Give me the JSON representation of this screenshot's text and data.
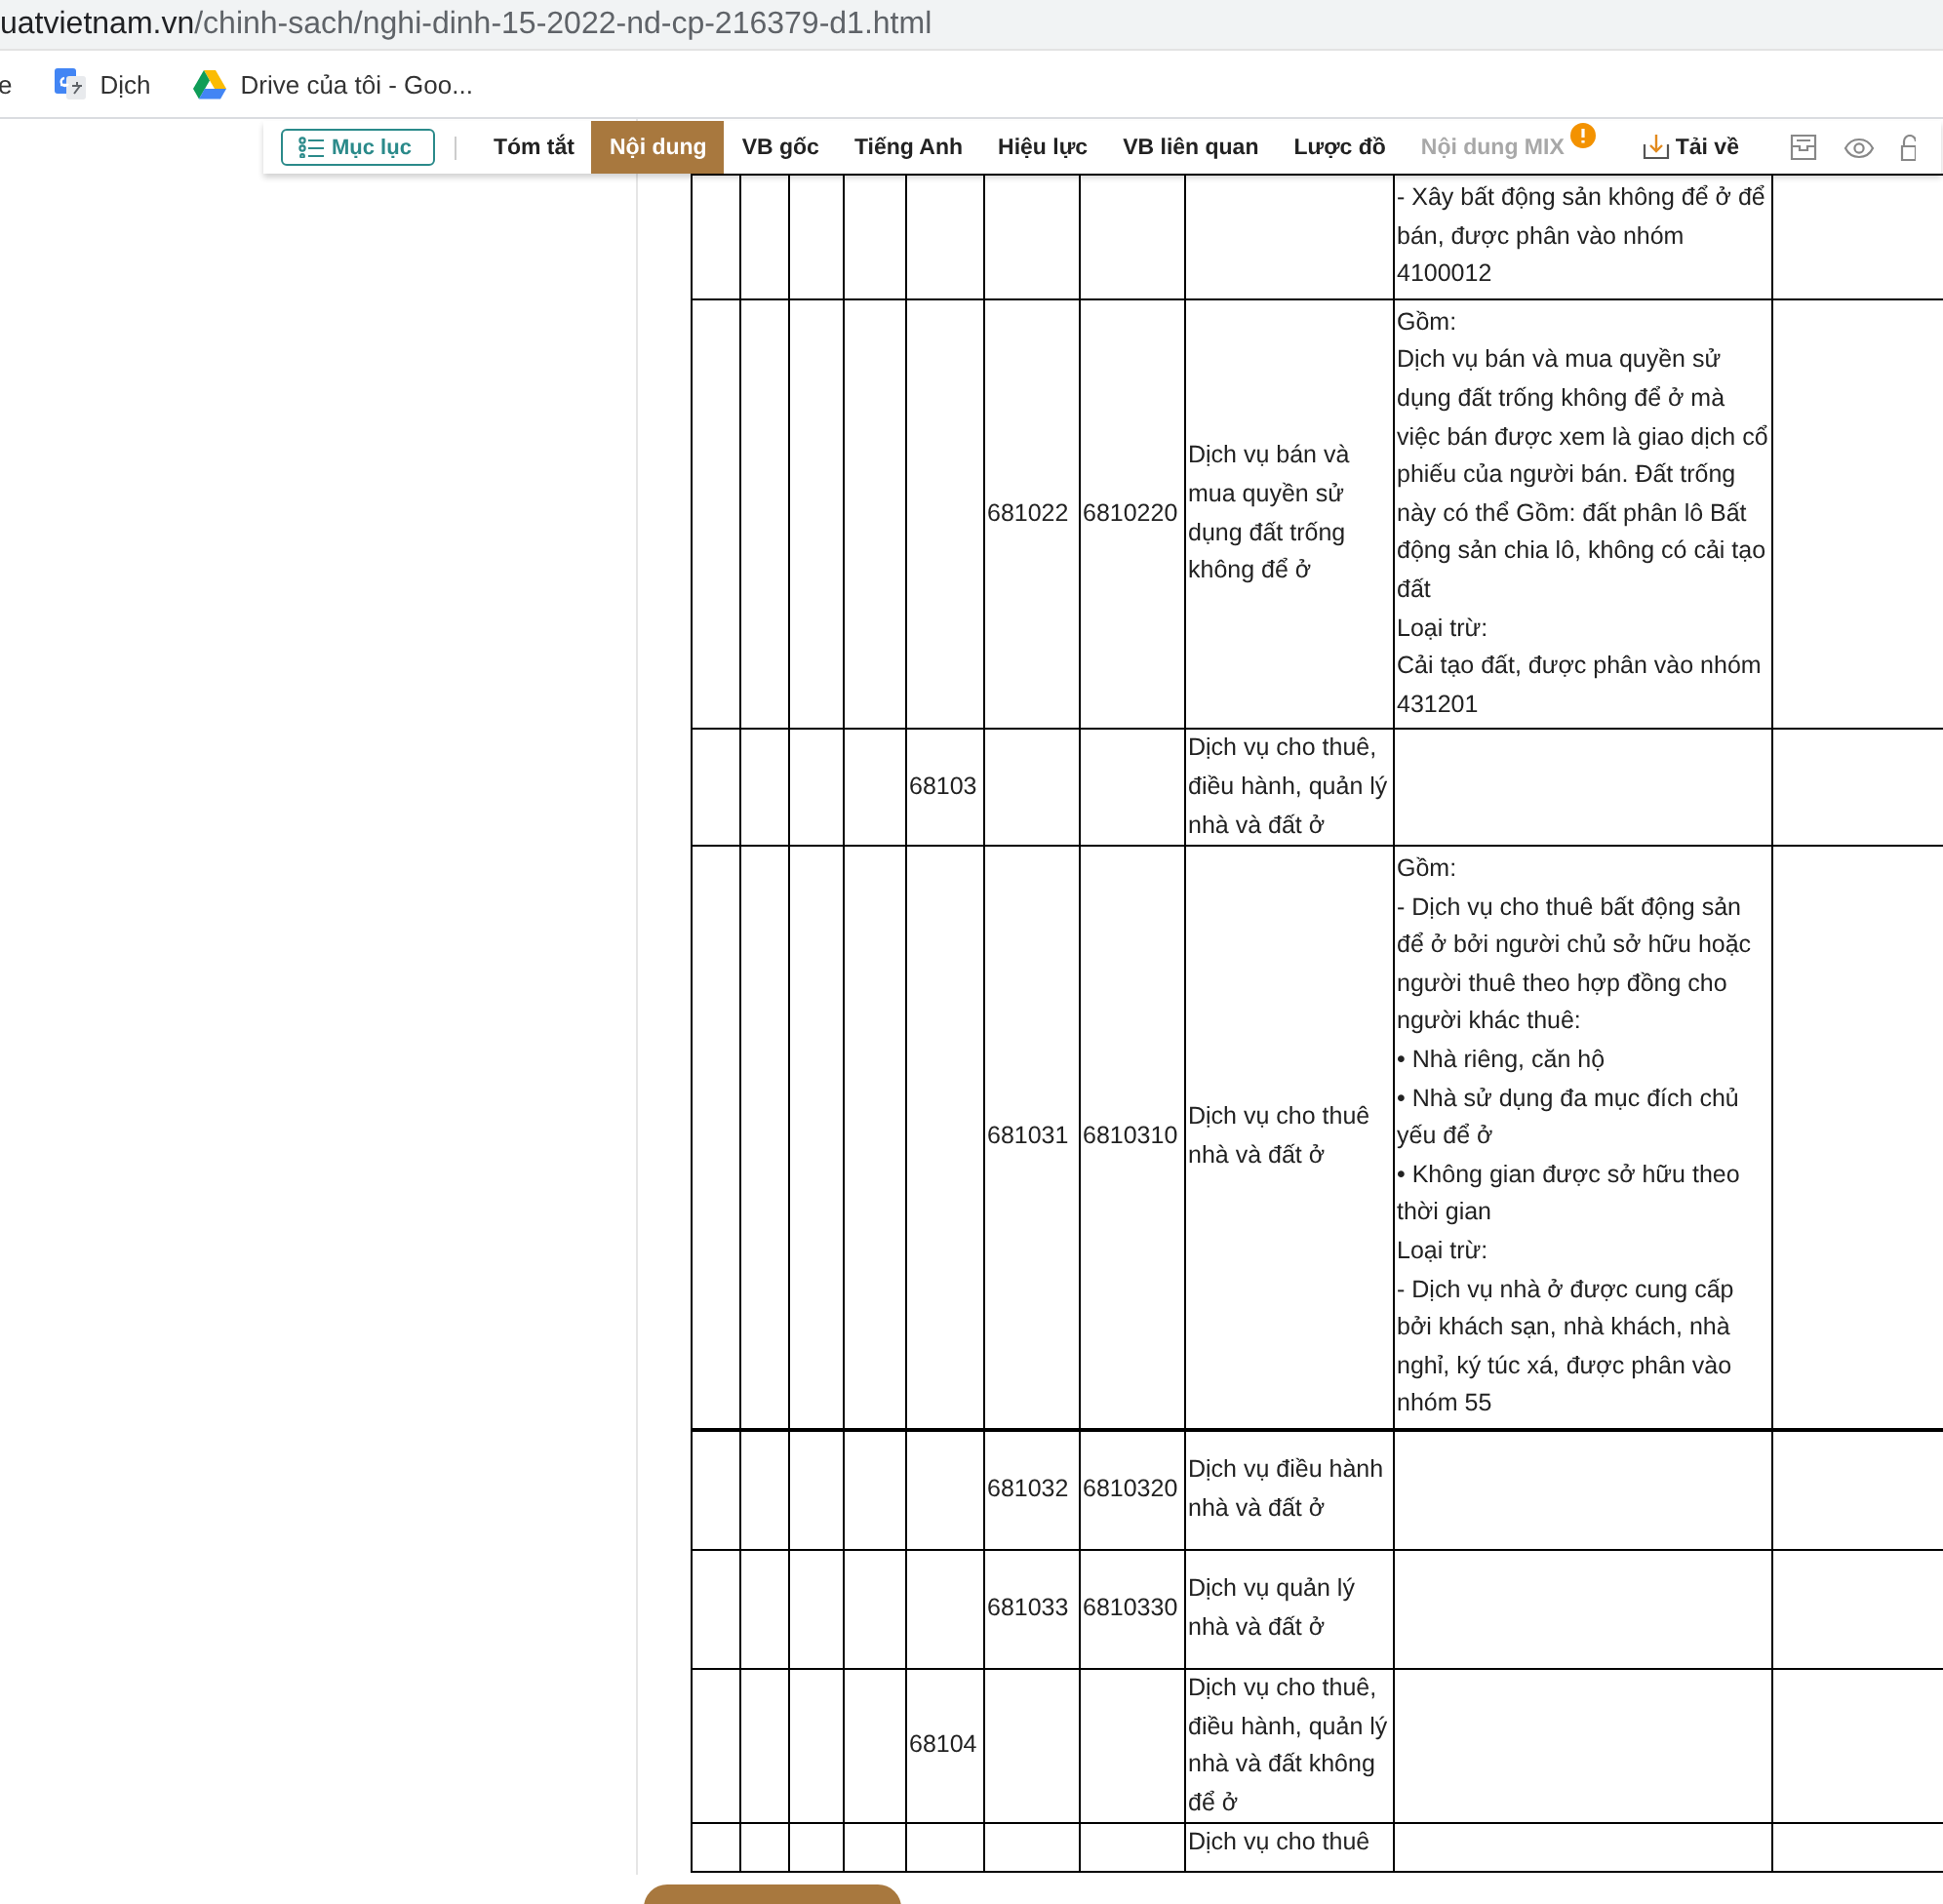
{
  "address_bar": {
    "host": "uatvietnam.vn",
    "path": "/chinh-sach/nghi-dinh-15-2022-nd-cp-216379-d1.html"
  },
  "bookmarks": [
    {
      "kind": "plain",
      "label": "e"
    },
    {
      "kind": "translate",
      "label": "Dịch"
    },
    {
      "kind": "drive",
      "label": "Drive của tôi - Goo..."
    }
  ],
  "toolbar": {
    "toc_button": "Mục lục",
    "tabs": [
      {
        "label": "Tóm tắt",
        "selected": false,
        "disabled": false
      },
      {
        "label": "Nội dung",
        "selected": true,
        "disabled": false
      },
      {
        "label": "VB gốc",
        "selected": false,
        "disabled": false
      },
      {
        "label": "Tiếng Anh",
        "selected": false,
        "disabled": false
      },
      {
        "label": "Hiệu lực",
        "selected": false,
        "disabled": false
      },
      {
        "label": "VB liên quan",
        "selected": false,
        "disabled": false
      },
      {
        "label": "Lược đồ",
        "selected": false,
        "disabled": false
      },
      {
        "label": "Nội dung MIX",
        "selected": false,
        "disabled": true,
        "badge": true
      }
    ],
    "download": "Tải về"
  },
  "table": {
    "rows": [
      {
        "column_9": [
          "- Xây bất động sản không để ở để bán, được phân vào nhóm 4100012"
        ]
      },
      {
        "column_6": "681022",
        "column_7": "6810220",
        "column_8": "Dịch vụ bán và mua quyền sử dụng đất trống không để ở",
        "column_9": [
          "Gồm:",
          "Dịch vụ bán và mua quyền sử dụng đất trống không để ở mà việc bán được xem là giao dịch cổ phiếu của người bán. Đất trống này có thể Gồm: đất phân lô Bất động sản chia lô, không có cải tạo đất",
          "Loại trừ:",
          "Cải tạo đất, được phân vào nhóm 431201"
        ]
      },
      {
        "column_5": "68103",
        "column_8": "Dịch vụ cho thuê, điều hành, quản lý nhà và đất ở"
      },
      {
        "column_6": "681031",
        "column_7": "6810310",
        "column_8": "Dịch vụ cho thuê nhà và đất ở",
        "column_9": [
          "Gồm:",
          "- Dịch vụ cho thuê bất động sản để ở bởi người chủ sở hữu hoặc người thuê theo hợp đồng cho người khác thuê:",
          "• Nhà riêng, căn hộ",
          "• Nhà sử dụng đa mục đích chủ yếu để ở",
          "• Không gian được sở hữu theo thời gian",
          "Loại trừ:",
          "- Dịch vụ nhà ở được cung cấp bởi khách sạn, nhà khách, nhà nghỉ, ký túc xá, được phân vào nhóm 55"
        ]
      },
      {
        "column_6": "681032",
        "column_7": "6810320",
        "column_8": "Dịch vụ điều hành nhà và đất ở"
      },
      {
        "column_6": "681033",
        "column_7": "6810330",
        "column_8": "Dịch vụ quản lý nhà và đất ở"
      },
      {
        "column_5": "68104",
        "column_8": "Dịch vụ cho thuê, điều hành, quản lý nhà và đất không để ở"
      },
      {
        "column_8": "Dịch vụ cho thuê"
      }
    ]
  }
}
